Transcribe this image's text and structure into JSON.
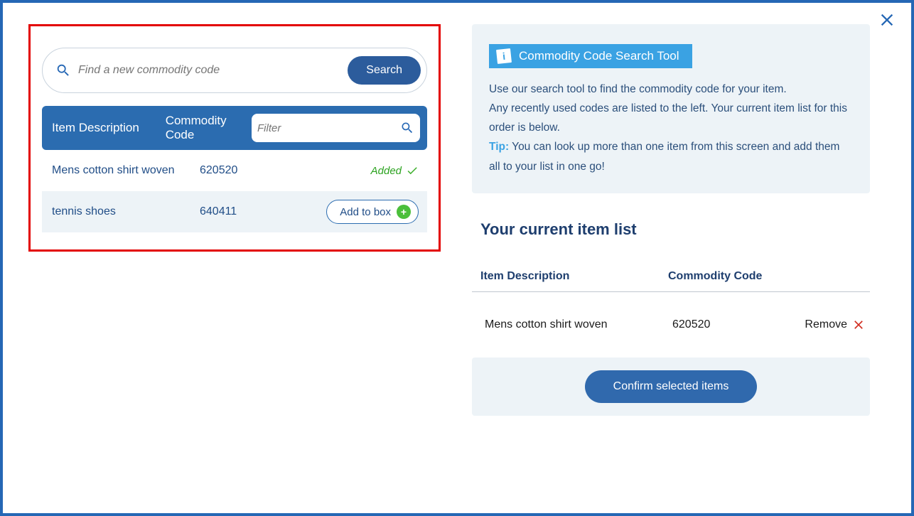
{
  "search": {
    "placeholder": "Find a new commodity code",
    "button_label": "Search"
  },
  "table_header": {
    "col_desc": "Item Description",
    "col_code": "Commodity Code",
    "filter_placeholder": "Filter"
  },
  "rows": [
    {
      "description": "Mens cotton shirt woven",
      "code": "620520",
      "status": "added",
      "status_label": "Added"
    },
    {
      "description": "tennis shoes",
      "code": "640411",
      "status": "addable",
      "add_label": "Add to box"
    }
  ],
  "info_panel": {
    "title": "Commodity Code Search Tool",
    "body_line1": "Use our search tool to find the commodity code for your item.",
    "body_line2": "Any recently used codes are listed to the left. Your current item list for this order is below.",
    "tip_label": "Tip:",
    "tip_text": " You can look up more than one item from this screen and add them all to your list in one go!"
  },
  "item_list": {
    "title": "Your current item list",
    "col_desc": "Item Description",
    "col_code": "Commodity Code",
    "rows": [
      {
        "description": "Mens cotton shirt woven",
        "code": "620520",
        "remove_label": "Remove"
      }
    ],
    "confirm_label": "Confirm selected items"
  }
}
